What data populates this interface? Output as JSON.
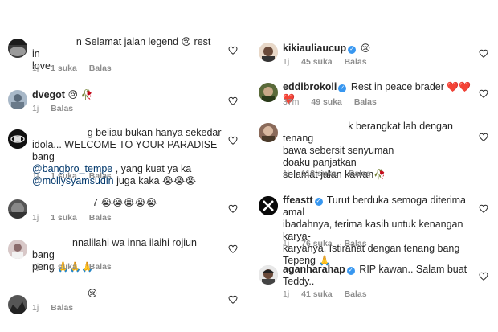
{
  "common": {
    "likes_suffix": "suka",
    "reply_label": "Balas"
  },
  "left": [
    {
      "text_a": "n Selamat jalan legend ",
      "emoji": "😢",
      "text_b": " rest in",
      "text_c": "love",
      "time": "1j",
      "likes": "1"
    },
    {
      "user": "dvegot",
      "emoji": "😢 🥀",
      "time": "1j"
    },
    {
      "line1": "g beliau bukan hanya sekedar",
      "line2": "idola... WELCOME TO YOUR PARADISE bang",
      "mention1": "@bangbro_tempe",
      "line3": " , yang kuat ya ka",
      "mention2": "@mollysyamsudin",
      "line4": " juga kaka ",
      "emoji": "😭😭😭",
      "time": "1j",
      "likes": "1"
    },
    {
      "text_a": "7 ",
      "emoji": "😭😭😭😭😭",
      "time": "1j",
      "likes": "1"
    },
    {
      "line1": "nnalilahi wa inna ilaihi rojiun bang",
      "line2": "peng ",
      "emoji": "🙏🙏🙏",
      "time": "1j",
      "likes": "1"
    },
    {
      "emoji": "😢",
      "time": "1j"
    }
  ],
  "right": [
    {
      "user": "kikiauliaucup",
      "emoji": "😢",
      "time": "1j",
      "likes": "45"
    },
    {
      "user": "eddibrokoli",
      "text": "Rest in peace brader ",
      "emoji": "❤️❤️❤️",
      "time": "37m",
      "likes": "49"
    },
    {
      "line1": "k berangkat lah dengan tenang",
      "line2": "bawa sebersit senyuman",
      "line3": "doaku panjatkan",
      "line4": "selamat jalan kawan",
      "emoji": "🥀",
      "time": "1j",
      "likes": "113"
    },
    {
      "user": "ffeastt",
      "line1": " Turut berduka semoga diterima amal",
      "line2": "ibadahnya, terima kasih untuk kenangan karya-",
      "line3": "karyanya. Istirahat dengan tenang bang",
      "line4": "Tepeng ",
      "emoji": "🙏",
      "time": "1j",
      "likes": "76"
    },
    {
      "user": "aganharahap",
      "line1": " RIP kawan.. Salam buat",
      "line2": "Teddy..",
      "time": "1j",
      "likes": "41"
    }
  ],
  "colors": {
    "username": "#262626",
    "mention": "#00376b",
    "meta": "#8e8e8e",
    "verified": "#3897f0",
    "heart_stroke": "#262626"
  }
}
